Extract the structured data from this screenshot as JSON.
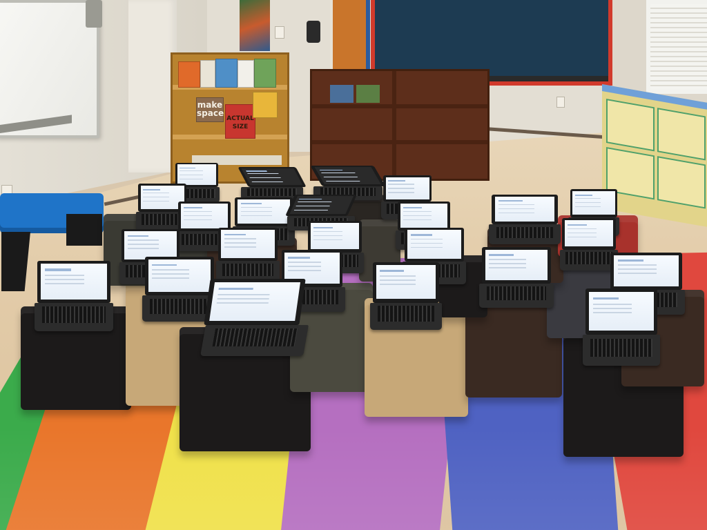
{
  "scene": {
    "type": "photograph",
    "caption": ""
  },
  "bookshelf": {
    "book_titles": [
      "make space",
      "ACTUAL SIZE"
    ]
  },
  "colors": {
    "mat_orange": "#e9762b",
    "mat_yellow": "#f0e14a",
    "mat_purple": "#b56fc0",
    "mat_blue": "#4f62c2",
    "mat_red": "#e0483e",
    "mat_green": "#3bab4b",
    "cube_black": "#1c1a1a",
    "cube_tan": "#c7a878",
    "cube_brown": "#3a2a22",
    "cube_olive": "#4b4a3f",
    "bench_blue": "#1f74c8",
    "laptop_screen": "#eef4fb"
  },
  "objects": {
    "laptop_count": 30,
    "cube_count": 16
  }
}
